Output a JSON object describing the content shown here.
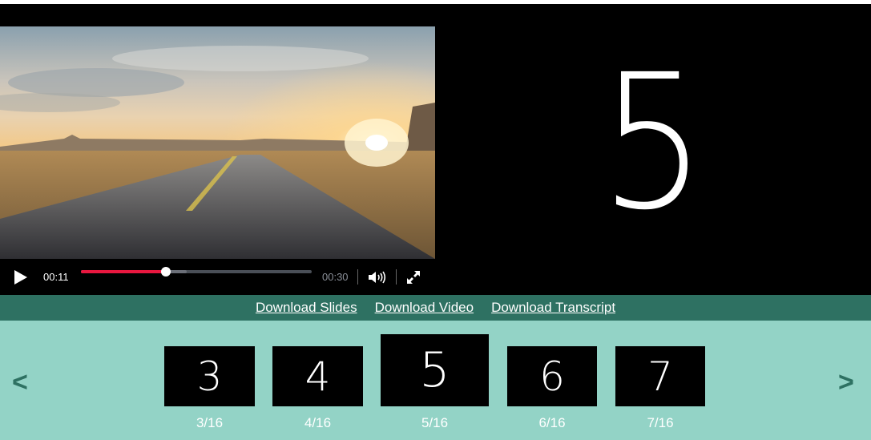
{
  "player": {
    "current_time": "00:11",
    "total_time": "00:30",
    "progress": 0.367,
    "buffered": 0.46
  },
  "current_slide": {
    "number": "5"
  },
  "downloads": {
    "slides": "Download Slides",
    "video": "Download Video",
    "transcript": "Download Transcript"
  },
  "strip": {
    "prev": "<",
    "next": ">",
    "thumbs": [
      {
        "number": "3",
        "caption": "3/16"
      },
      {
        "number": "4",
        "caption": "4/16"
      },
      {
        "number": "5",
        "caption": "5/16"
      },
      {
        "number": "6",
        "caption": "6/16"
      },
      {
        "number": "7",
        "caption": "7/16"
      }
    ]
  },
  "icons": {
    "play": "play-icon",
    "volume": "volume-icon",
    "fullscreen": "fullscreen-icon"
  },
  "colors": {
    "download_bar": "#2e7162",
    "strip": "#93d3c6",
    "progress": "#e8173f"
  }
}
